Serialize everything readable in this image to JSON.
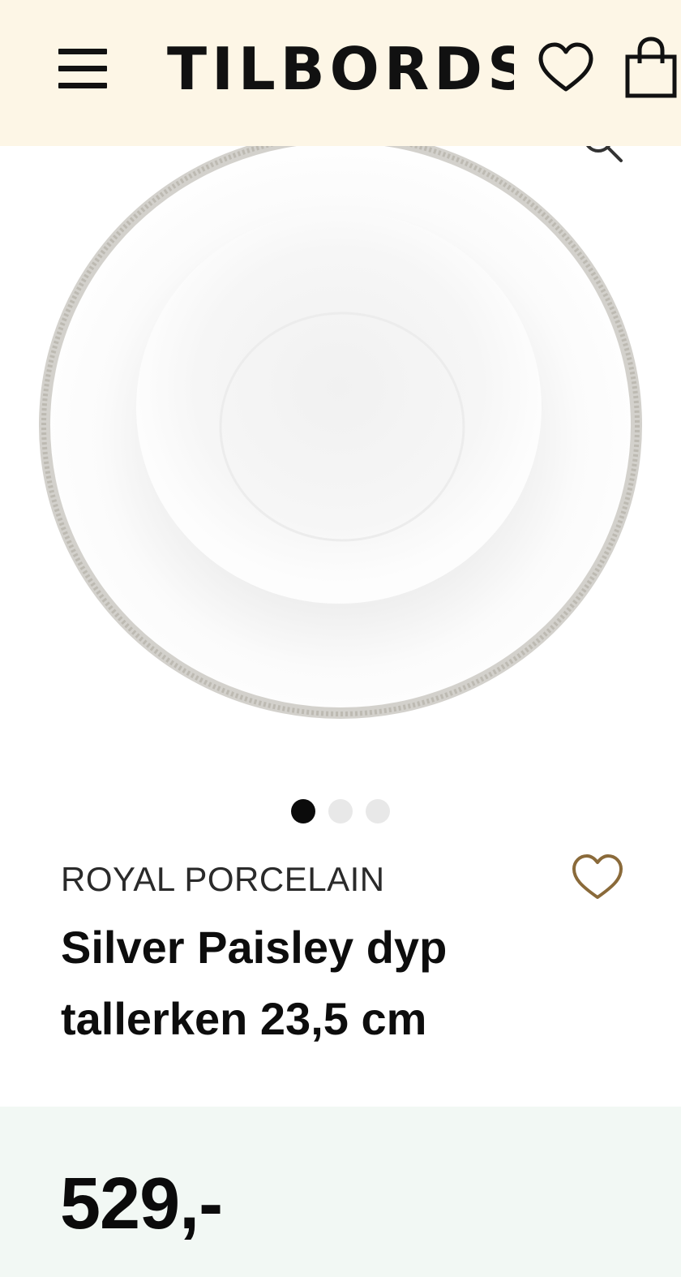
{
  "header": {
    "brand_logo": "TILBORDS",
    "background_color": "#fdf6e6",
    "icons": [
      "hamburger-menu-icon",
      "heart-icon",
      "shopping-bag-icon"
    ]
  },
  "carousel": {
    "image_alt": "Silver Paisley dyp tallerken",
    "slide_count": 3,
    "active_slide": 1,
    "icons": [
      "zoom-icon"
    ]
  },
  "product": {
    "brand": "ROYAL PORCELAIN",
    "title": "Silver Paisley dyp tallerken 23,5 cm",
    "wishlist_icon_color": "#8a6a3a"
  },
  "price": {
    "amount": "529,-",
    "panel_color": "#f2f8f4"
  }
}
